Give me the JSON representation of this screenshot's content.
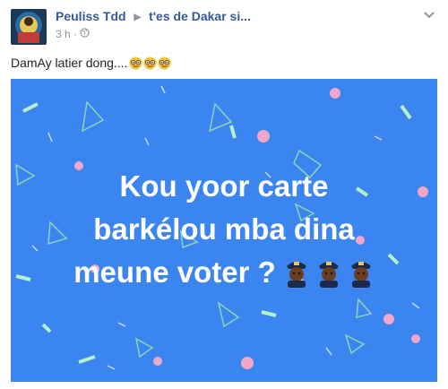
{
  "post": {
    "author": "Peuliss Tdd",
    "target": "t'es de Dakar si...",
    "time": "3 h",
    "separator": "·",
    "audience_icon": "globe-icon",
    "message": "DamAy latier dong....",
    "message_emojis": [
      "nerd-face-icon",
      "nerd-face-icon",
      "nerd-face-icon"
    ],
    "options_icon": "chevron-down-icon"
  },
  "image": {
    "background": "#3a85f0",
    "lines": [
      "Kou yoor carte",
      "barkélou mba dina",
      "meune voter ?"
    ],
    "line_emojis": [
      "police-officer-icon",
      "police-officer-icon",
      "police-officer-icon"
    ]
  }
}
